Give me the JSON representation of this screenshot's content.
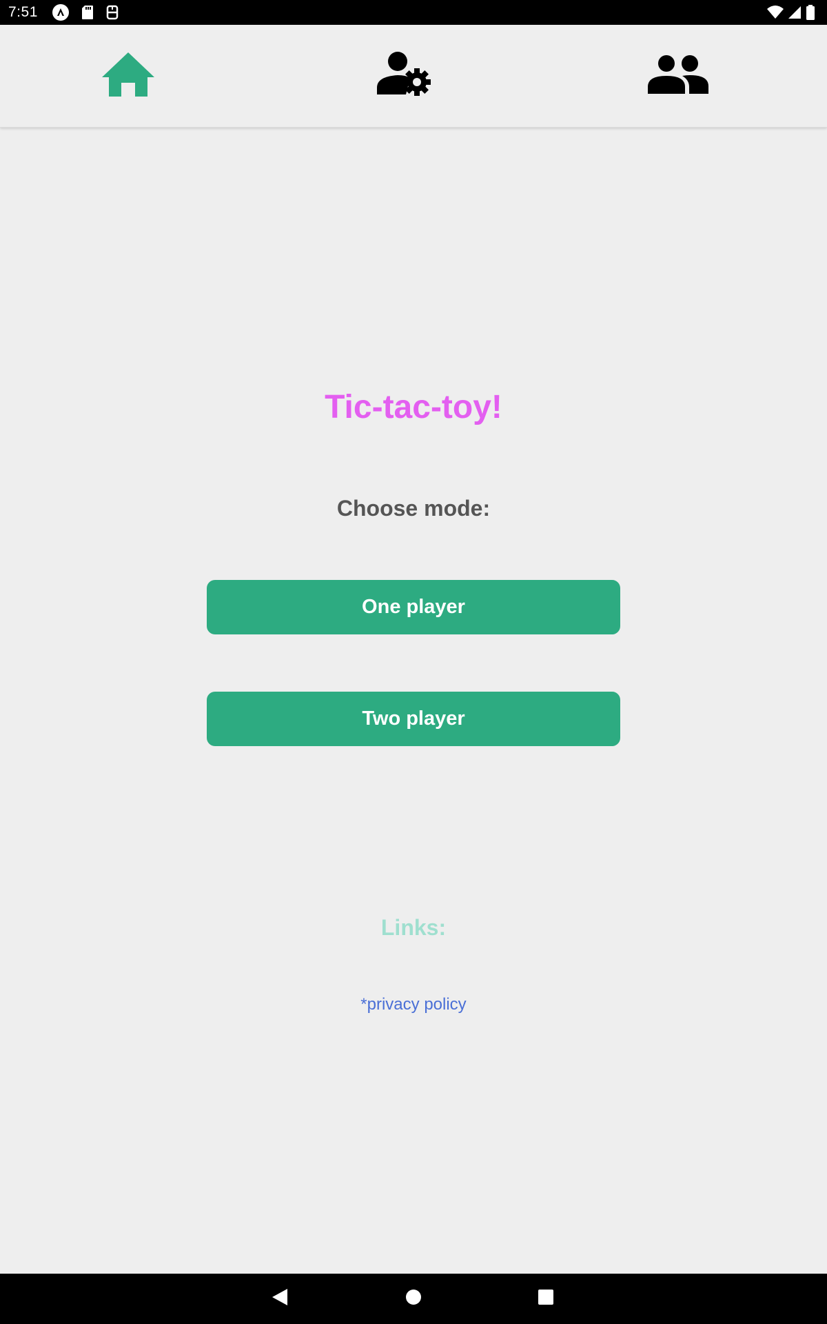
{
  "status_bar": {
    "time": "7:51",
    "left_icons": [
      "app-notification-icon",
      "sd-card-icon",
      "usb-debug-icon"
    ],
    "right_icons": [
      "wifi-icon",
      "cell-signal-icon",
      "battery-icon"
    ]
  },
  "top_nav": {
    "tabs": [
      {
        "name": "home",
        "icon": "home-icon",
        "active": true,
        "color": "#2dab81"
      },
      {
        "name": "player-settings",
        "icon": "person-gear-icon",
        "active": false,
        "color": "#000000"
      },
      {
        "name": "players",
        "icon": "group-icon",
        "active": false,
        "color": "#000000"
      }
    ]
  },
  "main": {
    "title": "Tic-tac-toy!",
    "subtitle": "Choose mode:",
    "buttons": {
      "one_player": "One player",
      "two_player": "Two player"
    },
    "links_heading": "Links:",
    "privacy_link": "*privacy policy"
  },
  "colors": {
    "accent": "#2dab81",
    "title": "#e35ff0",
    "link": "#4a6fd6",
    "links_heading": "#9fdfcf",
    "background": "#eeeeee"
  },
  "system_nav": {
    "buttons": [
      "back-icon",
      "home-circle-icon",
      "recents-square-icon"
    ]
  }
}
